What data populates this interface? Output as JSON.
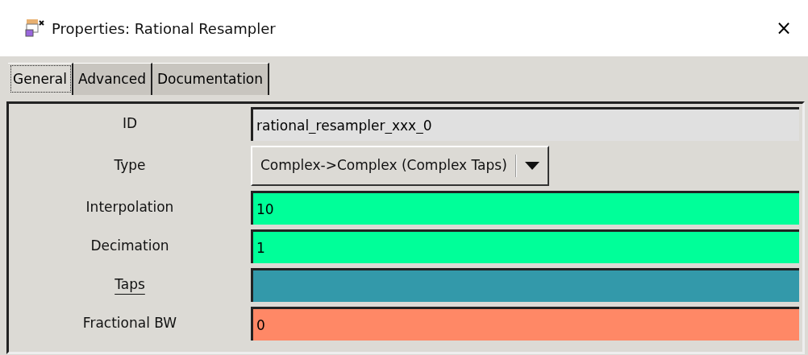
{
  "window": {
    "title": "Properties: Rational Resampler",
    "close": "×"
  },
  "tabs": [
    {
      "label": "General",
      "selected": true
    },
    {
      "label": "Advanced",
      "selected": false
    },
    {
      "label": "Documentation",
      "selected": false
    }
  ],
  "params": [
    {
      "label": "ID",
      "underlined": false,
      "kind": "readonly",
      "value": "rational_resampler_xxx_0"
    },
    {
      "label": "Type",
      "underlined": false,
      "kind": "combo",
      "value": "Complex->Complex (Complex Taps)"
    },
    {
      "label": "Interpolation",
      "underlined": false,
      "kind": "entry",
      "value": "10",
      "color": "#00ff99"
    },
    {
      "label": "Decimation",
      "underlined": false,
      "kind": "entry",
      "value": "1",
      "color": "#00ff99"
    },
    {
      "label": "Taps",
      "underlined": true,
      "kind": "entry",
      "color": "#3399aa"
    },
    {
      "label": "Fractional BW",
      "underlined": false,
      "kind": "entry",
      "value": "0",
      "color": "#ff8866"
    }
  ]
}
